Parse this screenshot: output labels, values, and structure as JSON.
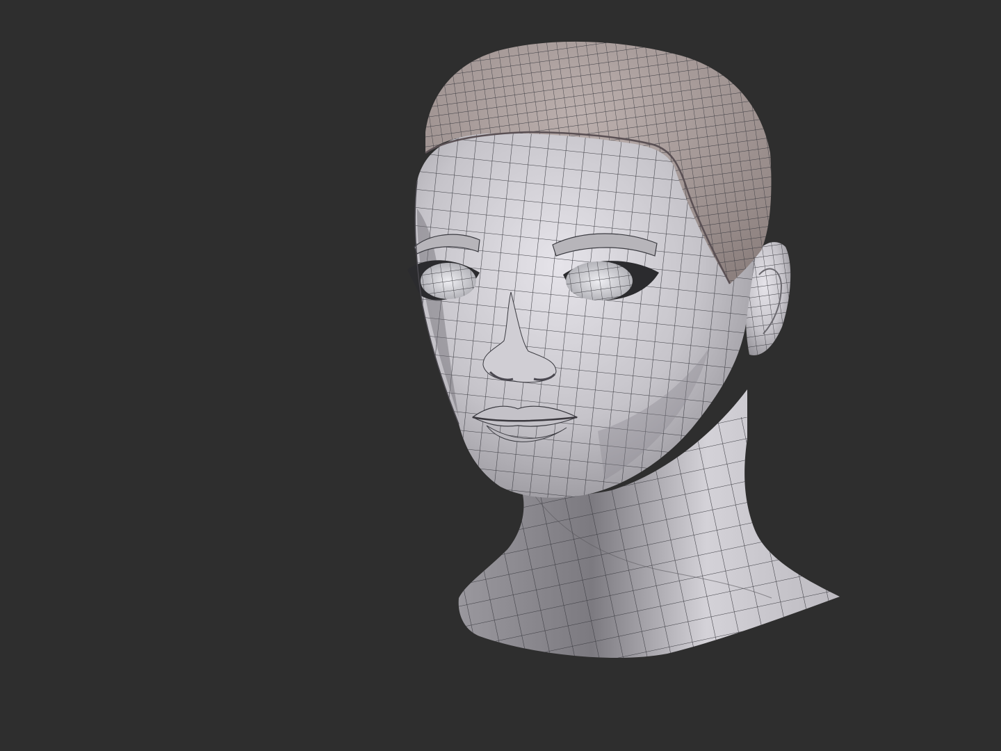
{
  "viewport": {
    "background_color": "#2e2e2e",
    "model": {
      "subject": "head-and-neck",
      "display_mode": "polyframe-wireframe-over-shaded",
      "skin_color": "#c9c7cc",
      "skin_highlight_color": "#e3e1e6",
      "skin_shadow_color": "#6f6d72",
      "hair_color": "#a69a98",
      "wire_color": "#3a3a40",
      "eye_color": "#d8d8de"
    }
  }
}
